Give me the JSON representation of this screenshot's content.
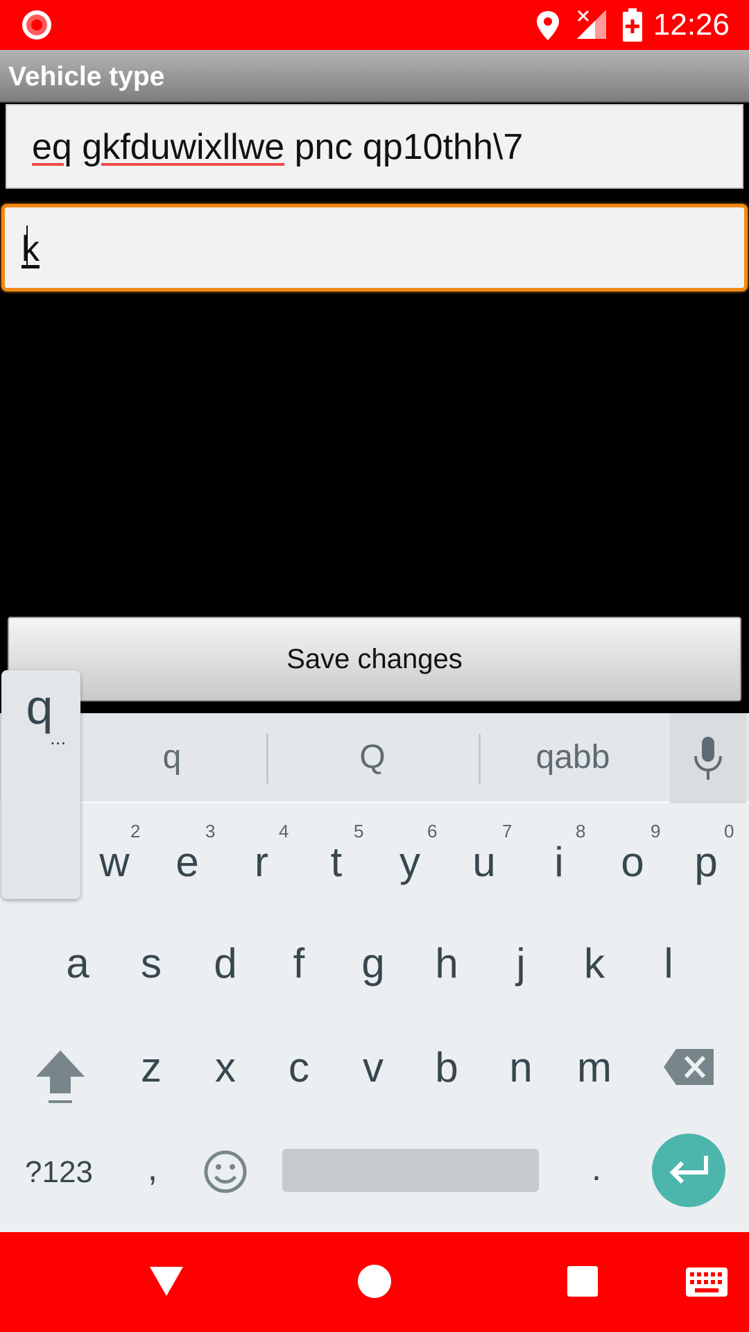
{
  "status_bar": {
    "time": "12:26",
    "icons": [
      "record-icon",
      "location-icon",
      "no-signal-icon",
      "battery-charging-icon"
    ],
    "background_color": "#ff0000"
  },
  "title_bar": {
    "title": "Vehicle type"
  },
  "form": {
    "field1_value": "eq gkfduwixllwe pnc qp10thh\\7",
    "field1_underlined_words": [
      "eq",
      "gkfduwixllwe"
    ],
    "field1_rest": " pnc qp10thh\\7",
    "field2_value": "k",
    "focus_color": "#f28a16"
  },
  "save_button": {
    "label": "Save changes"
  },
  "keyboard": {
    "suggestions": [
      "q",
      "Q",
      "qabb"
    ],
    "preview": {
      "letter": "q",
      "more": "..."
    },
    "row1": [
      {
        "key": "w",
        "hint": "2"
      },
      {
        "key": "e",
        "hint": "3"
      },
      {
        "key": "r",
        "hint": "4"
      },
      {
        "key": "t",
        "hint": "5"
      },
      {
        "key": "y",
        "hint": "6"
      },
      {
        "key": "u",
        "hint": "7"
      },
      {
        "key": "i",
        "hint": "8"
      },
      {
        "key": "o",
        "hint": "9"
      },
      {
        "key": "p",
        "hint": "0"
      }
    ],
    "row2": [
      "a",
      "s",
      "d",
      "f",
      "g",
      "h",
      "j",
      "k",
      "l"
    ],
    "row3": [
      "z",
      "x",
      "c",
      "v",
      "b",
      "n",
      "m"
    ],
    "symbols_label": "?123",
    "comma": ",",
    "period": ".",
    "enter_color": "#4db6ac"
  },
  "nav_bar": {
    "icons": [
      "back-icon",
      "home-icon",
      "recents-icon",
      "keyboard-icon"
    ],
    "background_color": "#ff0000"
  }
}
